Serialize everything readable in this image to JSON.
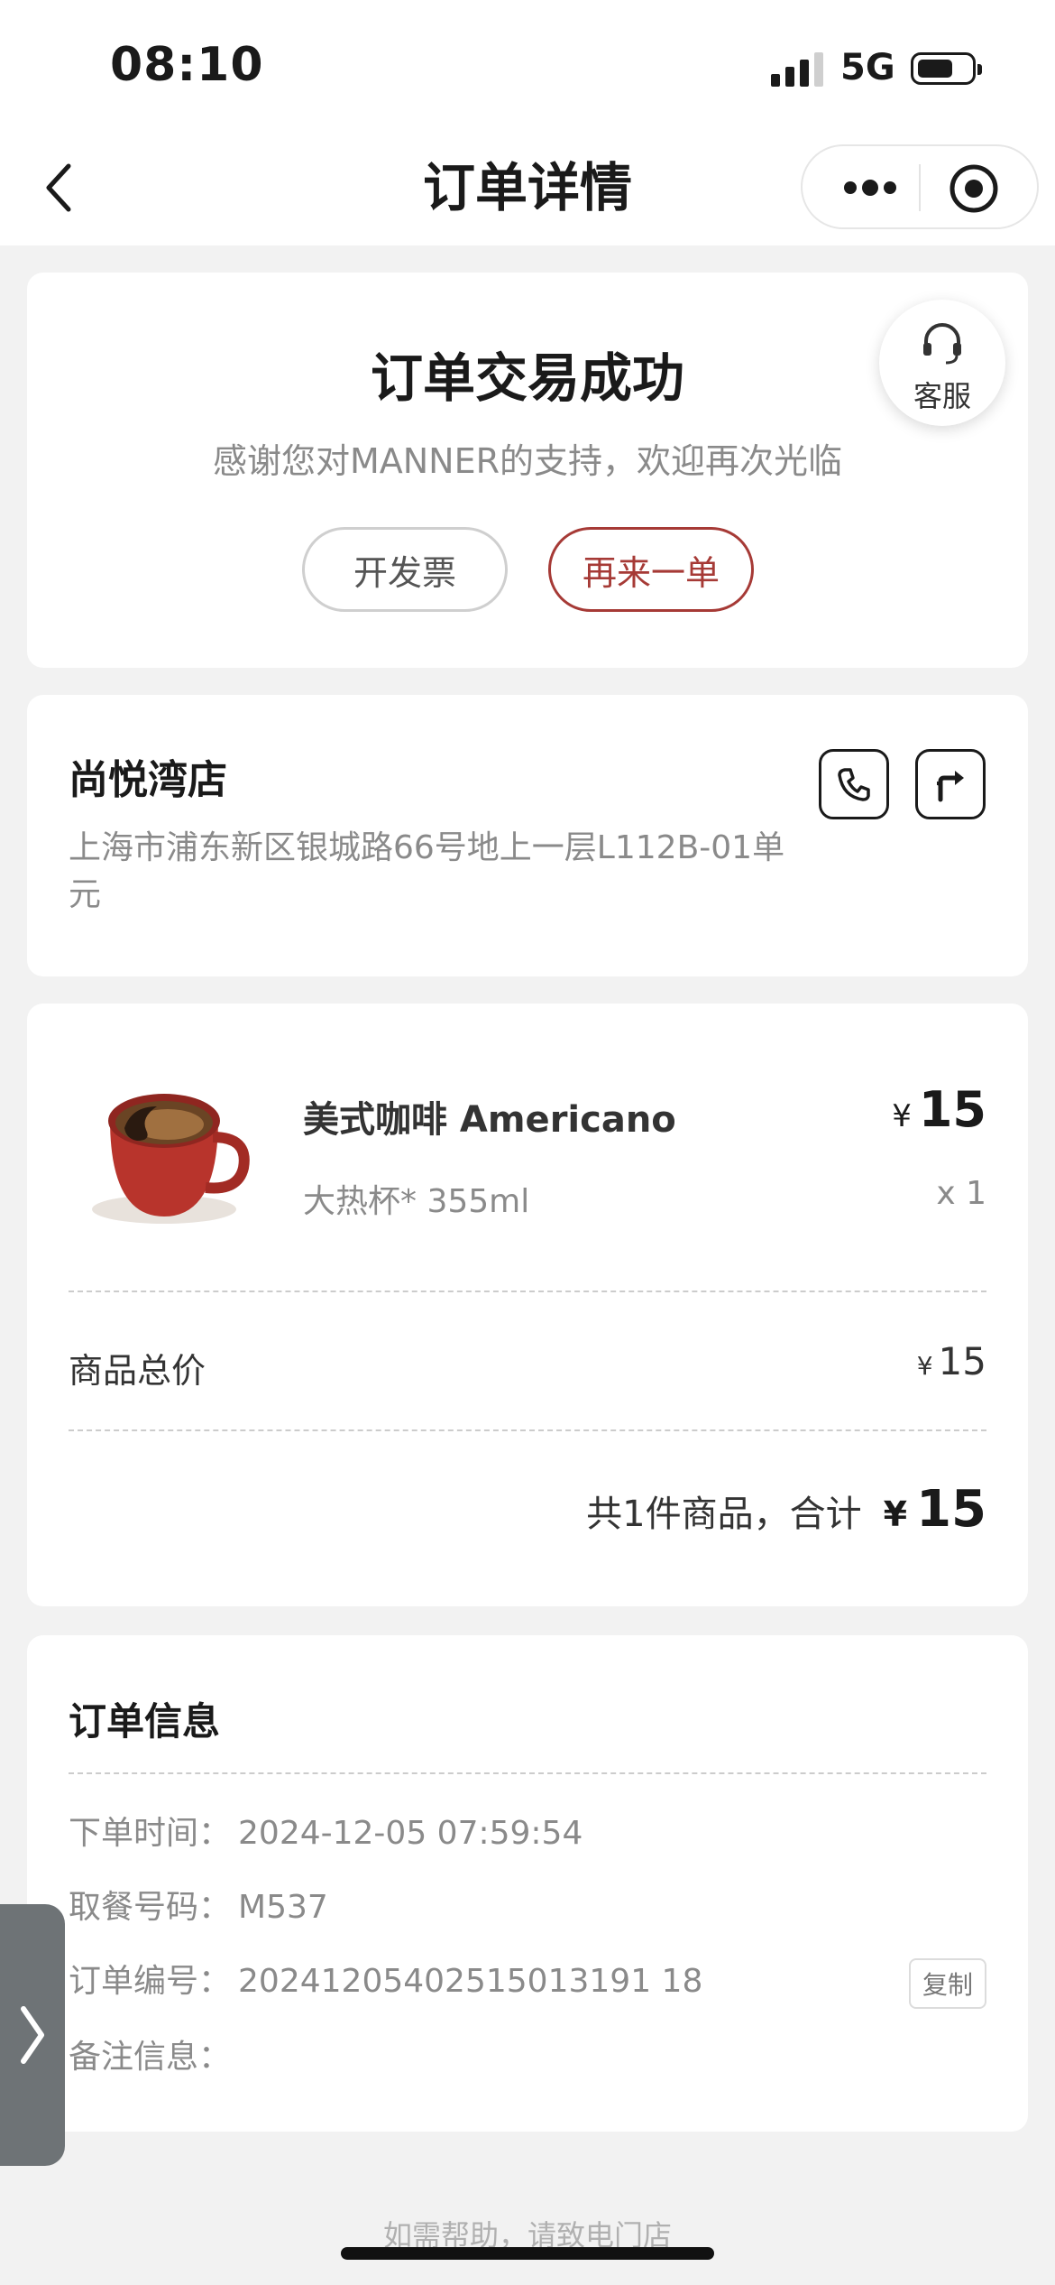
{
  "status_bar": {
    "time": "08:10",
    "network": "5G",
    "battery_level": 0.65
  },
  "nav": {
    "title": "订单详情",
    "back_icon": "chevron-left-icon",
    "more_icon": "more-dots-icon",
    "close_icon": "target-close-icon"
  },
  "status_card": {
    "title": "订单交易成功",
    "subtitle": "感谢您对MANNER的支持，欢迎再次光临",
    "invoice_label": "开发票",
    "reorder_label": "再来一单",
    "service_label": "客服",
    "service_icon": "headset-icon"
  },
  "store": {
    "name": "尚悦湾店",
    "address": "上海市浦东新区银城路66号地上一层L112B-01单元",
    "phone_icon": "phone-icon",
    "navigate_icon": "directions-icon"
  },
  "order_item": {
    "name": "美式咖啡 Americano",
    "currency": "¥",
    "price": "15",
    "spec": "大热杯* 355ml",
    "quantity": "x 1",
    "image": "coffee-cup-image"
  },
  "totals": {
    "goods_total_label": "商品总价",
    "goods_total_value": "15",
    "summary_text": "共1件商品，合计",
    "grand_total": "15",
    "currency": "¥"
  },
  "order_info": {
    "title": "订单信息",
    "rows": [
      {
        "label": "下单时间：",
        "value": "2024-12-05 07:59:54"
      },
      {
        "label": "取餐号码：",
        "value": "M537"
      },
      {
        "label": "订单编号：",
        "value": "20241205402515013191 18"
      },
      {
        "label": "备注信息：",
        "value": ""
      }
    ],
    "copy_label": "复制"
  },
  "footer": {
    "help_text": "如需帮助，请致电门店"
  },
  "colors": {
    "accent": "#a63a36",
    "muted": "#8a8a8a",
    "background": "#f2f2f2"
  }
}
